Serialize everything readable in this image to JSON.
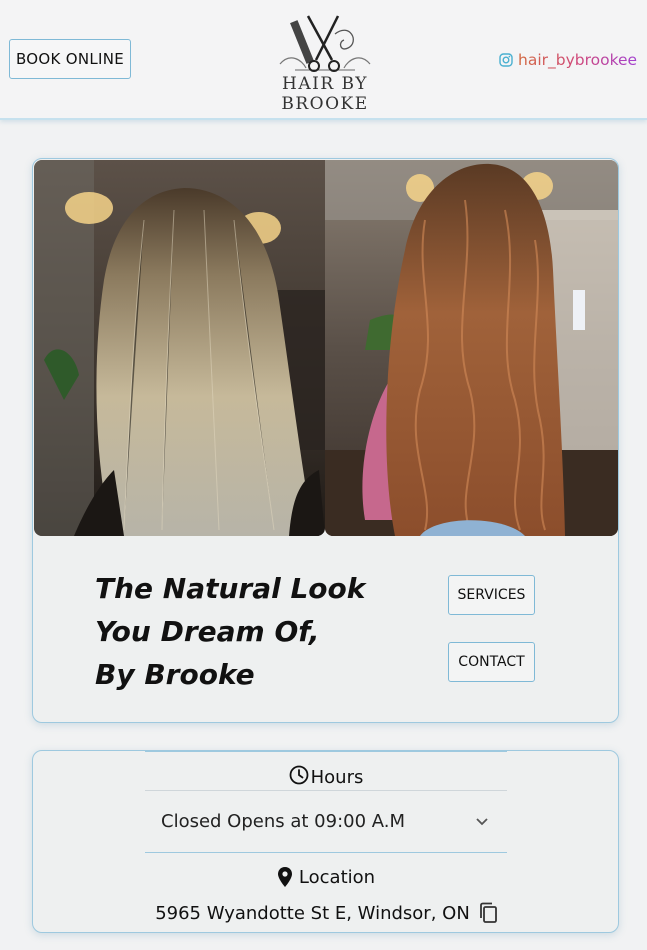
{
  "header": {
    "book_label": "BOOK ONLINE",
    "logo_text": "HAIR BY BROOKE",
    "instagram_handle": "hair_bybrookee"
  },
  "hero": {
    "tagline_lines": [
      "The Natural Look",
      "You Dream Of,",
      "By Brooke"
    ],
    "services_label": "SERVICES",
    "contact_label": "CONTACT"
  },
  "info": {
    "hours_label": "Hours",
    "hours_status": "Closed Opens at 09:00 A.M",
    "location_label": "Location",
    "address": "5965 Wyandotte St E, Windsor, ON"
  },
  "icons": {
    "instagram": "instagram-icon",
    "clock": "clock-icon",
    "chevron": "chevron-down-icon",
    "pin": "location-pin-icon",
    "copy": "copy-icon"
  },
  "colors": {
    "accent_border": "#7fb9d6",
    "page_bg": "#f1f2f3",
    "card_bg": "#eef0f0"
  }
}
